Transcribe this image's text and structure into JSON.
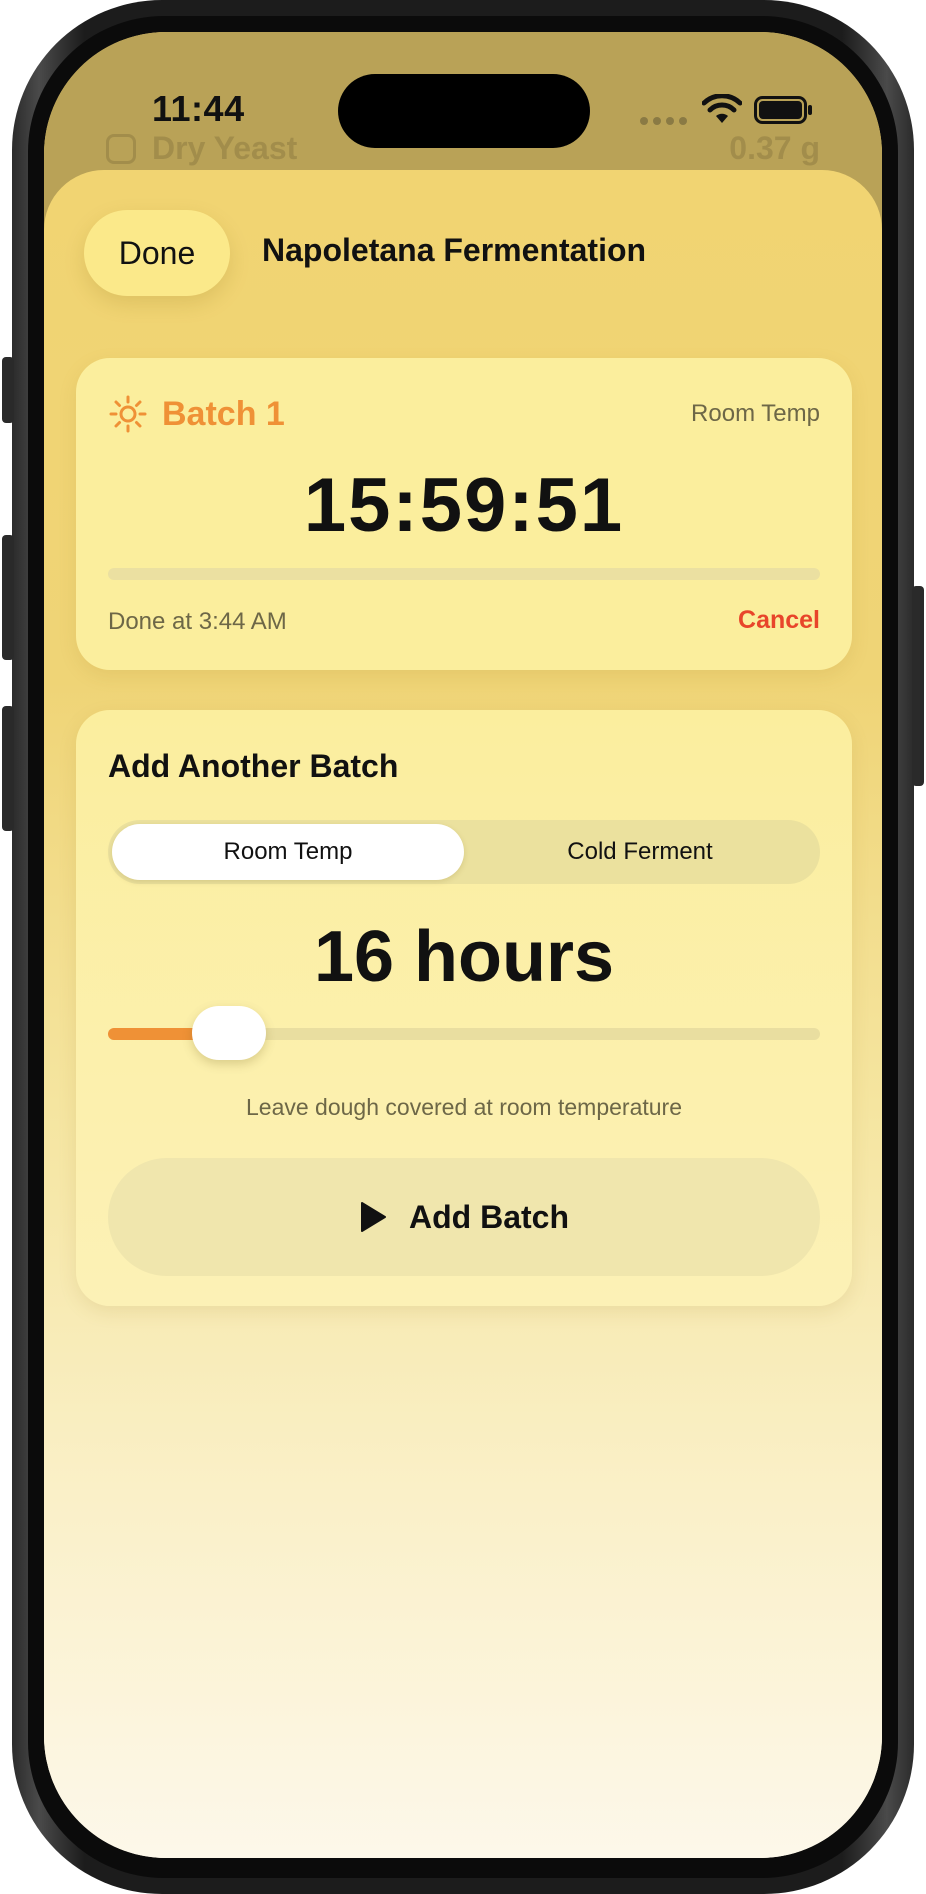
{
  "status_bar": {
    "time": "11:44"
  },
  "background_row": {
    "label": "Dry Yeast",
    "value": "0.37 g"
  },
  "header": {
    "done_label": "Done",
    "title": "Napoletana Fermentation"
  },
  "batch": {
    "name": "Batch 1",
    "mode": "Room Temp",
    "countdown": "15:59:51",
    "progress": 0.0,
    "done_at": "Done at 3:44 AM",
    "cancel_label": "Cancel"
  },
  "add_batch": {
    "title": "Add Another Batch",
    "segments": [
      {
        "label": "Room Temp",
        "selected": true
      },
      {
        "label": "Cold Ferment",
        "selected": false
      }
    ],
    "duration": "16 hours",
    "slider_fraction": 0.17,
    "hint": "Leave dough covered at room temperature",
    "button_label": "Add Batch"
  },
  "colors": {
    "accent": "#ef9136",
    "danger": "#e8452a",
    "card": "#fbee9d",
    "background": "#efd375"
  },
  "icons": {
    "batch": "sun-icon",
    "button": "play-icon",
    "wifi": "wifi-icon",
    "battery": "battery-icon"
  }
}
